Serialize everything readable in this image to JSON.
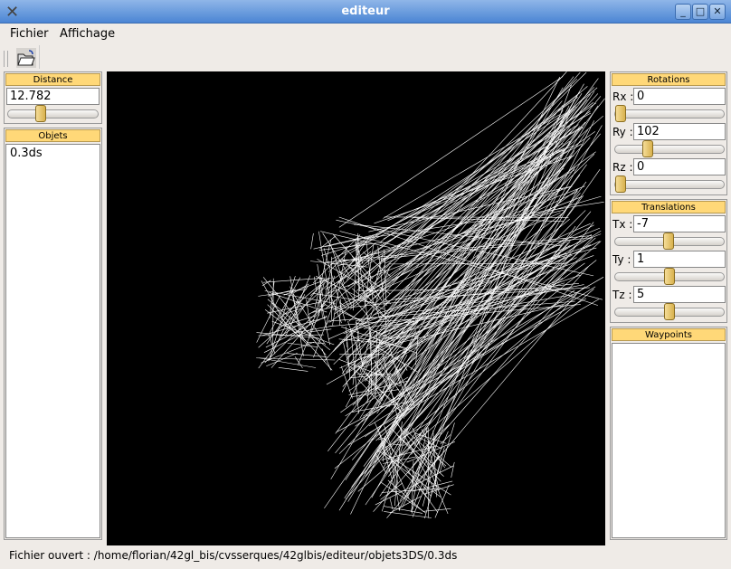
{
  "window": {
    "title": "editeur",
    "buttons": [
      "minimize",
      "maximize",
      "close"
    ]
  },
  "menu": [
    {
      "label": "Fichier"
    },
    {
      "label": "Affichage"
    }
  ],
  "toolbar": {
    "open_icon": "folder-open-icon"
  },
  "left": {
    "distance": {
      "header": "Distance",
      "value": "12.782",
      "slider_fraction": 0.35
    },
    "objets": {
      "header": "Objets",
      "items": [
        "0.3ds"
      ]
    }
  },
  "right": {
    "rotations": {
      "header": "Rotations",
      "rows": [
        {
          "label": "Rx :",
          "value": "0",
          "slider_fraction": 0.0
        },
        {
          "label": "Ry :",
          "value": "102",
          "slider_fraction": 0.28
        },
        {
          "label": "Rz :",
          "value": "0",
          "slider_fraction": 0.0
        }
      ]
    },
    "translations": {
      "header": "Translations",
      "rows": [
        {
          "label": "Tx :",
          "value": "-7",
          "slider_fraction": 0.49
        },
        {
          "label": "Ty :",
          "value": "1",
          "slider_fraction": 0.5
        },
        {
          "label": "Tz :",
          "value": "5",
          "slider_fraction": 0.5
        }
      ]
    },
    "waypoints": {
      "header": "Waypoints"
    }
  },
  "status": "Fichier ouvert : /home/florian/42gl_bis/cvsserques/42glbis/editeur/objets3DS/0.3ds",
  "colors": {
    "header": "#ffd878",
    "titlebar": "#4b85d4",
    "viewport": "#000000"
  }
}
